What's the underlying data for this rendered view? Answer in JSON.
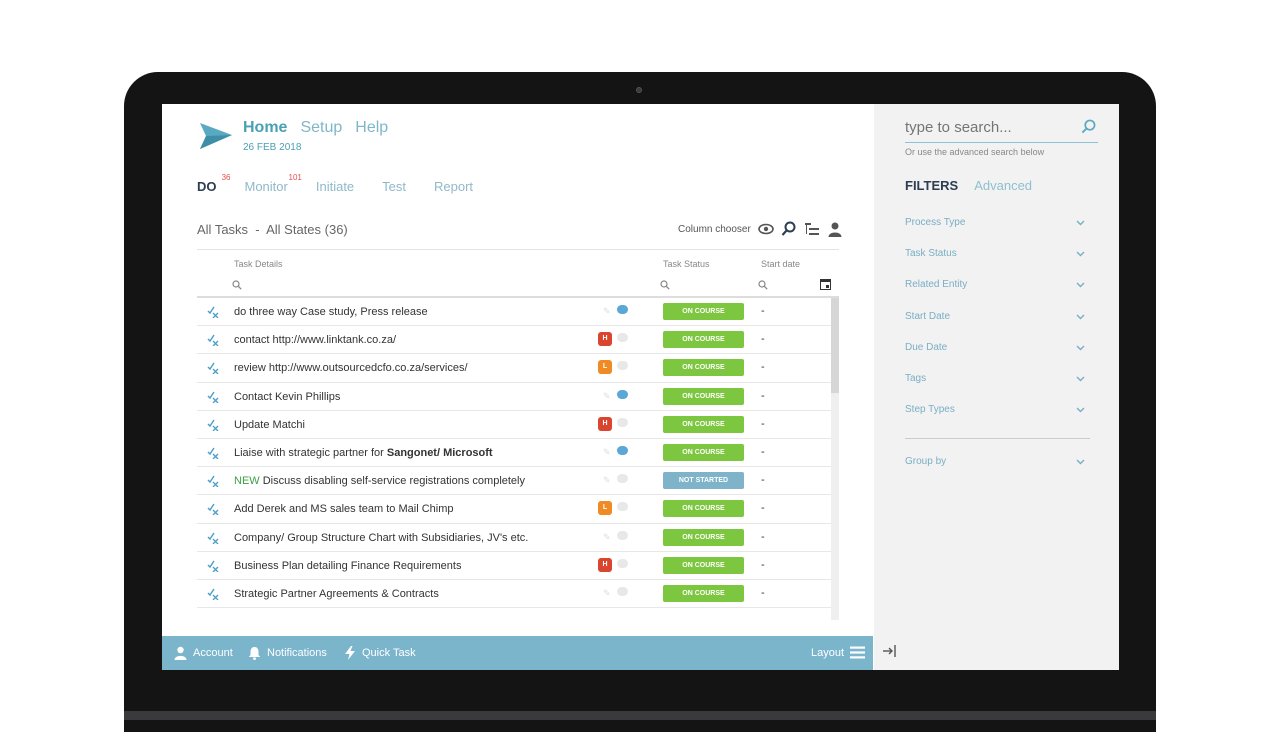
{
  "app": {
    "nav": [
      "Home",
      "Setup",
      "Help"
    ],
    "date": "26 FEB 2018"
  },
  "tabs": [
    {
      "label": "DO",
      "count": "36"
    },
    {
      "label": "Monitor",
      "count": "101"
    },
    {
      "label": "Initiate",
      "count": ""
    },
    {
      "label": "Test",
      "count": ""
    },
    {
      "label": "Report",
      "count": ""
    }
  ],
  "tasks_title": "All Tasks  -  All States (36)",
  "toolbar": {
    "column_chooser": "Column chooser"
  },
  "grid": {
    "headers": {
      "details": "Task Details",
      "status": "Task Status",
      "start": "Start date"
    },
    "rows": [
      {
        "text": "do three way Case study, Press release",
        "bold": "",
        "prefix": "",
        "priority": "",
        "comment": true,
        "status": "ON COURSE",
        "status_kind": "oc",
        "start": "-"
      },
      {
        "text": "contact http://www.linktank.co.za/",
        "bold": "",
        "prefix": "",
        "priority": "H",
        "comment": false,
        "status": "ON COURSE",
        "status_kind": "oc",
        "start": "-"
      },
      {
        "text": "review http://www.outsourcedcfo.co.za/services/",
        "bold": "",
        "prefix": "",
        "priority": "L",
        "comment": false,
        "status": "ON COURSE",
        "status_kind": "oc",
        "start": "-"
      },
      {
        "text": "Contact Kevin Phillips",
        "bold": "",
        "prefix": "",
        "priority": "",
        "comment": true,
        "status": "ON COURSE",
        "status_kind": "oc",
        "start": "-"
      },
      {
        "text": "Update Matchi",
        "bold": "",
        "prefix": "",
        "priority": "H",
        "comment": false,
        "status": "ON COURSE",
        "status_kind": "oc",
        "start": "-"
      },
      {
        "text": "Liaise with strategic partner for ",
        "bold": "Sangonet/ Microsoft",
        "prefix": "",
        "priority": "",
        "comment": true,
        "status": "ON COURSE",
        "status_kind": "oc",
        "start": "-"
      },
      {
        "text": " Discuss disabling self-service registrations completely",
        "bold": "",
        "prefix": "NEW",
        "priority": "",
        "comment": false,
        "status": "NOT STARTED",
        "status_kind": "ns",
        "start": "-"
      },
      {
        "text": "Add Derek and MS sales team to Mail Chimp",
        "bold": "",
        "prefix": "",
        "priority": "L",
        "comment": false,
        "status": "ON COURSE",
        "status_kind": "oc",
        "start": "-"
      },
      {
        "text": "Company/ Group Structure Chart with Subsidiaries, JV's etc.",
        "bold": "",
        "prefix": "",
        "priority": "",
        "comment": false,
        "status": "ON COURSE",
        "status_kind": "oc",
        "start": "-"
      },
      {
        "text": "Business Plan detailing Finance Requirements",
        "bold": "",
        "prefix": "",
        "priority": "H",
        "comment": false,
        "status": "ON COURSE",
        "status_kind": "oc",
        "start": "-"
      },
      {
        "text": "Strategic Partner Agreements & Contracts",
        "bold": "",
        "prefix": "",
        "priority": "",
        "comment": false,
        "status": "ON COURSE",
        "status_kind": "oc",
        "start": "-"
      }
    ]
  },
  "bottombar": {
    "account": "Account",
    "notifications": "Notifications",
    "quick_task": "Quick Task",
    "layout": "Layout"
  },
  "side": {
    "search_placeholder": "type to search...",
    "adv_hint": "Or use the advanced search below",
    "filters_label": "FILTERS",
    "advanced_label": "Advanced",
    "filters": [
      "Process Type",
      "Task Status",
      "Related Entity",
      "Start Date",
      "Due Date",
      "Tags",
      "Step Types"
    ],
    "group_by": "Group by"
  },
  "colors": {
    "accent": "#4aa0b5",
    "on_course": "#7dc63f",
    "not_started": "#7fb3c9",
    "bar": "#7ab5cc"
  }
}
